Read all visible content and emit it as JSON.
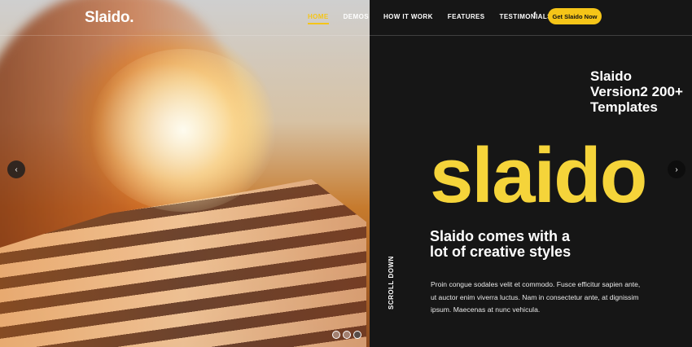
{
  "header": {
    "logo": "Slaido.",
    "nav": [
      "HOME",
      "DEMOS",
      "HOW IT WORK",
      "FEATURES",
      "TESTIMONIALS"
    ],
    "active_nav": "HOME",
    "social_icon": "facebook-icon",
    "social_glyph": "f",
    "cta_label": "Get Slaido Now"
  },
  "hero": {
    "side_title": "Slaido Version2 200+ Templates",
    "big_word": "slaido",
    "headline": "Slaido comes with a lot of creative styles",
    "paragraph": "Proin congue sodales velit et commodo. Fusce efficitur sapien ante, ut auctor enim viverra luctus. Nam in consectetur ante, at dignissim ipsum. Maecenas at nunc vehicula.",
    "scroll_label": "SCROLL DOWN",
    "prev_arrow": "‹",
    "next_arrow": "›",
    "slide_count": 3,
    "active_slide": 3
  },
  "colors": {
    "accent": "#f5c518",
    "big_word": "#f5d43a",
    "background_dark": "#161616"
  }
}
